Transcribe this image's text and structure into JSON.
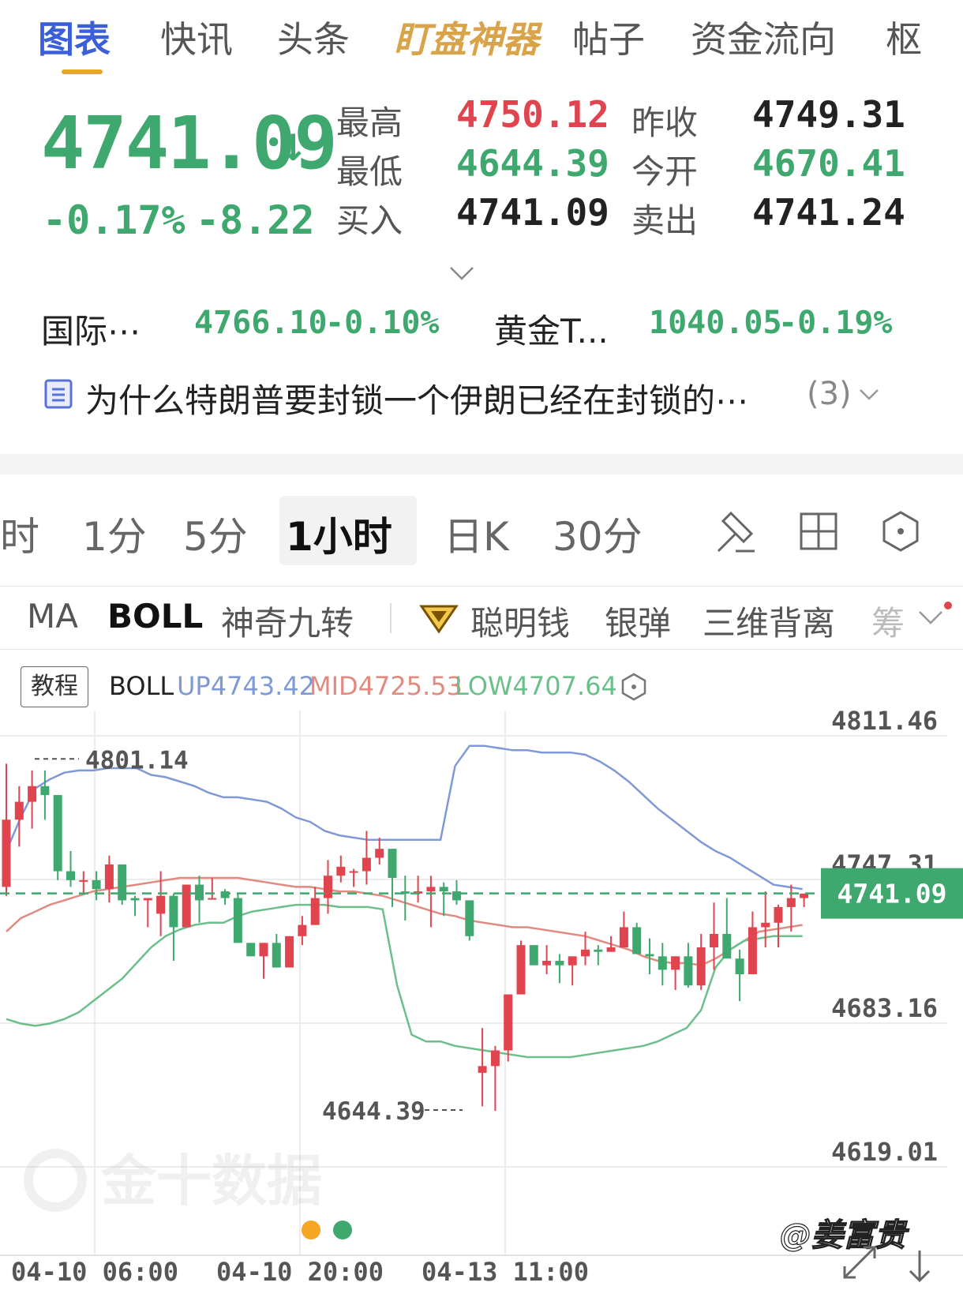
{
  "top_tabs": [
    {
      "label": "图表",
      "state": "active"
    },
    {
      "label": "快讯",
      "state": "normal"
    },
    {
      "label": "头条",
      "state": "normal"
    },
    {
      "label": "盯盘神器",
      "state": "special"
    },
    {
      "label": "帖子",
      "state": "normal"
    },
    {
      "label": "资金流向",
      "state": "normal"
    },
    {
      "label": "枢",
      "state": "normal"
    }
  ],
  "quote": {
    "price": "4741.09",
    "arrow": "↓",
    "change_pct": "-0.17%",
    "change": "-8.22",
    "high_label": "最高",
    "high": "4750.12",
    "prev_close_label": "昨收",
    "prev_close": "4749.31",
    "low_label": "最低",
    "low": "4644.39",
    "open_label": "今开",
    "open": "4670.41",
    "bid_label": "买入",
    "bid": "4741.09",
    "ask_label": "卖出",
    "ask": "4741.24"
  },
  "related": [
    {
      "name": "国际⋯",
      "price": "4766.10",
      "pct": "-0.10%"
    },
    {
      "name": "黄金T...",
      "price": "1040.05",
      "pct": "-0.19%"
    }
  ],
  "news": {
    "text": "为什么特朗普要封锁一个伊朗已经在封锁的⋯",
    "count": "(3)"
  },
  "period_tabs": [
    "时",
    "1分",
    "5分",
    "1小时",
    "日K",
    "30分"
  ],
  "period_active": "1小时",
  "indicator_tabs": [
    "MA",
    "BOLL",
    "神奇九转",
    "聪明钱",
    "银弹",
    "三维背离",
    "筹"
  ],
  "indicator_active": "BOLL",
  "boll": {
    "badge": "教程",
    "name": "BOLL",
    "up": "UP4743.42",
    "mid": "MID4725.53",
    "low": "LOW4707.64"
  },
  "colors": {
    "up_line": "#7f98d6",
    "mid_line": "#e08a80",
    "low_line": "#6bbf8a",
    "bull": "#e0444e",
    "bear": "#3fa86e",
    "accent": "#3b5fd9"
  },
  "chart_data": {
    "type": "candlestick",
    "title": "",
    "y_ticks": [
      "4811.46",
      "4747.31",
      "4683.16",
      "4619.01"
    ],
    "ylim": [
      4619.01,
      4811.46
    ],
    "x_ticks": [
      "04-10 06:00",
      "04-10 20:00",
      "04-13 11:00"
    ],
    "max_marker": "4801.14",
    "min_marker": "4644.39",
    "current_price": "4741.09",
    "candles": [
      {
        "o": 4744,
        "h": 4799,
        "l": 4740,
        "c": 4774
      },
      {
        "o": 4774,
        "h": 4789,
        "l": 4762,
        "c": 4782
      },
      {
        "o": 4782,
        "h": 4796,
        "l": 4770,
        "c": 4789
      },
      {
        "o": 4789,
        "h": 4796,
        "l": 4774,
        "c": 4785
      },
      {
        "o": 4785,
        "h": 4785,
        "l": 4747,
        "c": 4751
      },
      {
        "o": 4751,
        "h": 4760,
        "l": 4744,
        "c": 4747
      },
      {
        "o": 4747,
        "h": 4751,
        "l": 4741,
        "c": 4747
      },
      {
        "o": 4747,
        "h": 4751,
        "l": 4738,
        "c": 4743
      },
      {
        "o": 4743,
        "h": 4758,
        "l": 4737,
        "c": 4754
      },
      {
        "o": 4754,
        "h": 4754,
        "l": 4736,
        "c": 4738
      },
      {
        "o": 4739,
        "h": 4740,
        "l": 4731,
        "c": 4738
      },
      {
        "o": 4738,
        "h": 4739,
        "l": 4726,
        "c": 4739
      },
      {
        "o": 4732,
        "h": 4751,
        "l": 4722,
        "c": 4740
      },
      {
        "o": 4740,
        "h": 4741,
        "l": 4711,
        "c": 4726
      },
      {
        "o": 4726,
        "h": 4745,
        "l": 4726,
        "c": 4745
      },
      {
        "o": 4745,
        "h": 4749,
        "l": 4728,
        "c": 4738
      },
      {
        "o": 4739,
        "h": 4748,
        "l": 4739,
        "c": 4739
      },
      {
        "o": 4742,
        "h": 4743,
        "l": 4736,
        "c": 4739
      },
      {
        "o": 4739,
        "h": 4741,
        "l": 4719,
        "c": 4719
      },
      {
        "o": 4719,
        "h": 4719,
        "l": 4715,
        "c": 4713
      },
      {
        "o": 4713,
        "h": 4719,
        "l": 4703,
        "c": 4719
      },
      {
        "o": 4719,
        "h": 4723,
        "l": 4708,
        "c": 4708
      },
      {
        "o": 4708,
        "h": 4722,
        "l": 4708,
        "c": 4722
      },
      {
        "o": 4722,
        "h": 4731,
        "l": 4718,
        "c": 4727
      },
      {
        "o": 4727,
        "h": 4744,
        "l": 4727,
        "c": 4739
      },
      {
        "o": 4739,
        "h": 4756,
        "l": 4732,
        "c": 4749
      },
      {
        "o": 4749,
        "h": 4758,
        "l": 4746,
        "c": 4753
      },
      {
        "o": 4751,
        "h": 4752,
        "l": 4744,
        "c": 4751
      },
      {
        "o": 4751,
        "h": 4769,
        "l": 4745,
        "c": 4757
      },
      {
        "o": 4757,
        "h": 4766,
        "l": 4754,
        "c": 4761
      },
      {
        "o": 4761,
        "h": 4761,
        "l": 4735,
        "c": 4748
      },
      {
        "o": 4742,
        "h": 4749,
        "l": 4729,
        "c": 4741
      },
      {
        "o": 4741,
        "h": 4749,
        "l": 4737,
        "c": 4742
      },
      {
        "o": 4742,
        "h": 4749,
        "l": 4726,
        "c": 4744
      },
      {
        "o": 4744,
        "h": 4746,
        "l": 4731,
        "c": 4742
      },
      {
        "o": 4742,
        "h": 4747,
        "l": 4736,
        "c": 4738
      },
      {
        "o": 4738,
        "h": 4738,
        "l": 4720,
        "c": 4722
      },
      {
        "o": 4661,
        "h": 4681,
        "l": 4646,
        "c": 4664
      },
      {
        "o": 4664,
        "h": 4673,
        "l": 4644,
        "c": 4671
      },
      {
        "o": 4671,
        "h": 4695,
        "l": 4666,
        "c": 4696
      },
      {
        "o": 4696,
        "h": 4720,
        "l": 4696,
        "c": 4718
      },
      {
        "o": 4718,
        "h": 4718,
        "l": 4712,
        "c": 4709
      },
      {
        "o": 4709,
        "h": 4718,
        "l": 4705,
        "c": 4711
      },
      {
        "o": 4711,
        "h": 4714,
        "l": 4701,
        "c": 4709
      },
      {
        "o": 4709,
        "h": 4713,
        "l": 4700,
        "c": 4713
      },
      {
        "o": 4713,
        "h": 4724,
        "l": 4709,
        "c": 4716
      },
      {
        "o": 4716,
        "h": 4718,
        "l": 4709,
        "c": 4715
      },
      {
        "o": 4715,
        "h": 4722,
        "l": 4715,
        "c": 4717
      },
      {
        "o": 4717,
        "h": 4733,
        "l": 4717,
        "c": 4726
      },
      {
        "o": 4726,
        "h": 4728,
        "l": 4714,
        "c": 4714
      },
      {
        "o": 4714,
        "h": 4721,
        "l": 4705,
        "c": 4713
      },
      {
        "o": 4713,
        "h": 4719,
        "l": 4700,
        "c": 4707
      },
      {
        "o": 4707,
        "h": 4713,
        "l": 4698,
        "c": 4713
      },
      {
        "o": 4713,
        "h": 4719,
        "l": 4699,
        "c": 4700
      },
      {
        "o": 4700,
        "h": 4723,
        "l": 4698,
        "c": 4717
      },
      {
        "o": 4717,
        "h": 4737,
        "l": 4707,
        "c": 4723
      },
      {
        "o": 4723,
        "h": 4739,
        "l": 4712,
        "c": 4712
      },
      {
        "o": 4712,
        "h": 4716,
        "l": 4693,
        "c": 4705
      },
      {
        "o": 4705,
        "h": 4733,
        "l": 4705,
        "c": 4726
      },
      {
        "o": 4726,
        "h": 4742,
        "l": 4717,
        "c": 4728
      },
      {
        "o": 4728,
        "h": 4736,
        "l": 4717,
        "c": 4735
      },
      {
        "o": 4735,
        "h": 4745,
        "l": 4724,
        "c": 4739
      },
      {
        "o": 4739,
        "h": 4741,
        "l": 4735,
        "c": 4741
      }
    ],
    "boll_up": [
      4760,
      4775,
      4788,
      4792,
      4795,
      4796,
      4796,
      4797,
      4797,
      4797,
      4794,
      4793,
      4791,
      4789,
      4786,
      4784,
      4784,
      4783,
      4782,
      4779,
      4775,
      4773,
      4769,
      4767,
      4766,
      4765,
      4765,
      4765,
      4765,
      4765,
      4765,
      4798,
      4807,
      4807,
      4806,
      4805,
      4805,
      4804,
      4804,
      4804,
      4803,
      4800,
      4796,
      4791,
      4785,
      4779,
      4774,
      4769,
      4764,
      4760,
      4757,
      4753,
      4749,
      4745,
      4744,
      4743
    ],
    "boll_mid": [
      4724,
      4730,
      4733,
      4736,
      4738,
      4740,
      4742,
      4743,
      4744,
      4745,
      4746,
      4747,
      4748,
      4748,
      4748,
      4748,
      4748,
      4747,
      4746,
      4745,
      4744,
      4744,
      4743,
      4742,
      4742,
      4741,
      4740,
      4738,
      4736,
      4734,
      4732,
      4731,
      4729,
      4728,
      4727,
      4726,
      4726,
      4725,
      4724,
      4723,
      4722,
      4720,
      4718,
      4716,
      4713,
      4711,
      4710,
      4710,
      4709,
      4712,
      4716,
      4720,
      4724,
      4725,
      4726,
      4727
    ],
    "boll_low": [
      4685,
      4683,
      4682,
      4683,
      4685,
      4688,
      4693,
      4698,
      4703,
      4710,
      4717,
      4722,
      4725,
      4727,
      4728,
      4728,
      4731,
      4733,
      4734,
      4735,
      4736,
      4736,
      4736,
      4735,
      4735,
      4735,
      4734,
      4700,
      4678,
      4675,
      4675,
      4673,
      4672,
      4671,
      4670,
      4669,
      4668,
      4668,
      4668,
      4668,
      4669,
      4670,
      4671,
      4672,
      4673,
      4675,
      4678,
      4681,
      4689,
      4708,
      4716,
      4720,
      4721,
      4722,
      4722,
      4722
    ]
  },
  "watermark": "金十数据",
  "signature": "@姜富贵"
}
